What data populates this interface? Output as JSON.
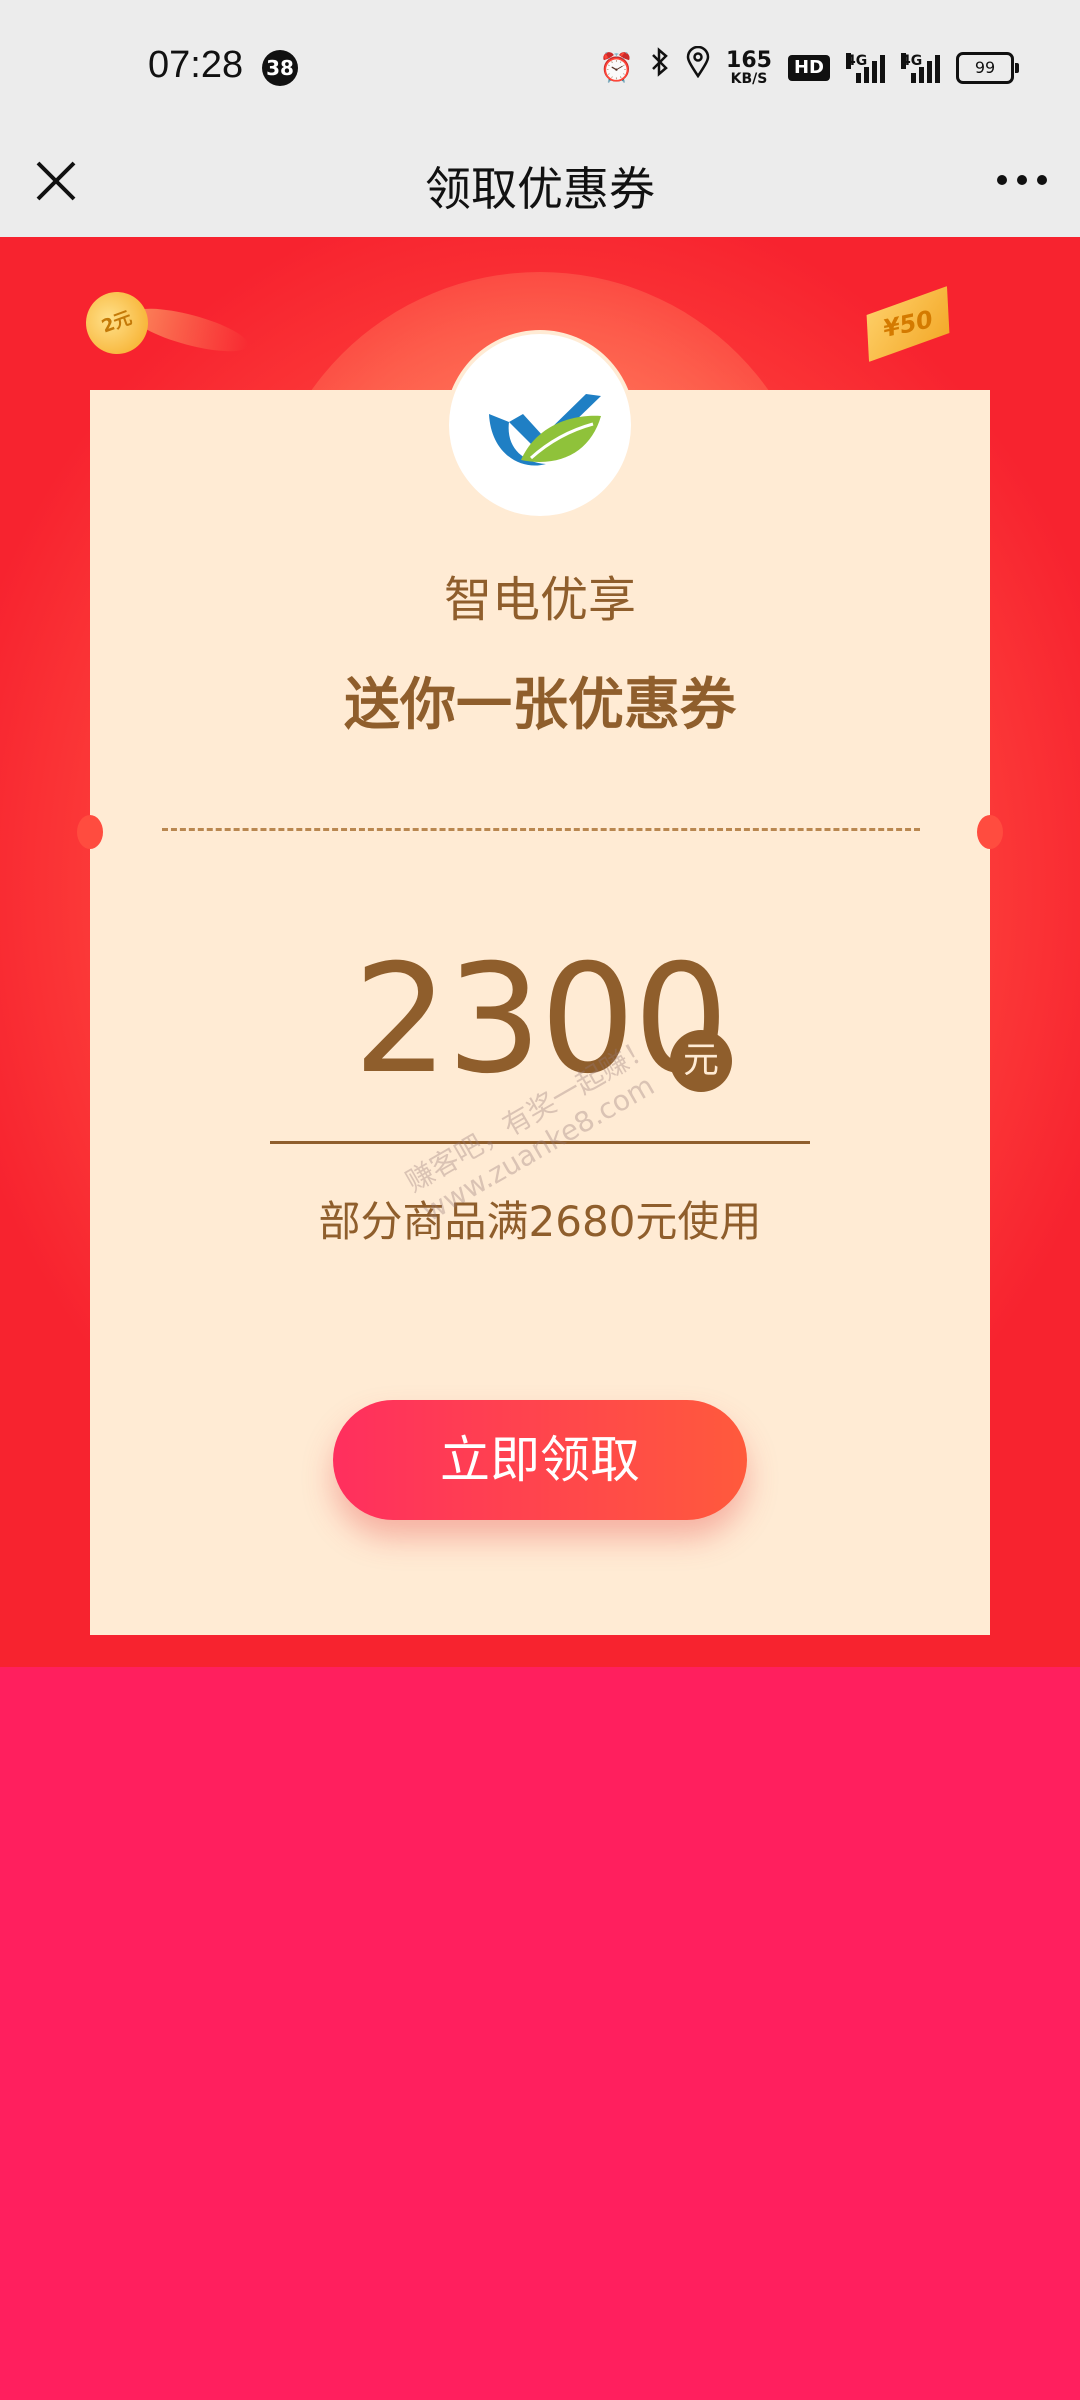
{
  "status_bar": {
    "time": "07:28",
    "notification_count": "38",
    "net_speed_value": "165",
    "net_speed_unit": "KB/S",
    "hd_label": "HD",
    "signal1_label": "4G",
    "signal2_label": "4G",
    "battery": "99"
  },
  "nav": {
    "title": "领取优惠券",
    "close_icon": "close-icon",
    "more_icon": "more-icon"
  },
  "decor": {
    "coin_text": "2元",
    "note_text": "¥50"
  },
  "coupon": {
    "brand": "智电优享",
    "headline": "送你一张优惠券",
    "amount": "2300",
    "unit": "元",
    "condition": "部分商品满2680元使用",
    "claim_button": "立即领取"
  },
  "watermark": {
    "line1": "赚客吧，有奖一起赚！",
    "line2": "www.zuanke8.com"
  },
  "colors": {
    "page_bg": "#ff1f5e",
    "card_bg": "#ffebd4",
    "text_brown": "#8f5e2c",
    "button_start": "#ff2f5e",
    "button_end": "#ff5a3c"
  }
}
